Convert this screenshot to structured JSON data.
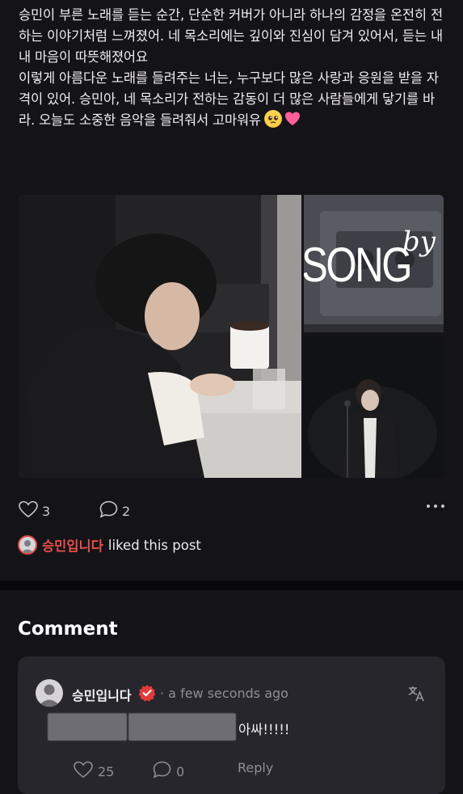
{
  "post": {
    "body": "승민이 부른 노래를 듣는 순간, 단순한 커버가 아니라 하나의 감정을 온전히 전하는 이야기처럼 느껴졌어. 네 목소리에는 깊이와 진심이 담겨 있어서, 듣는 내내 마음이 따뜻해졌어요\n이렇게 아름다운 노래를 들려주는 너는, 누구보다 많은 사랑과 응원을 받을 자격이 있어. 승민아, 네 목소리가 전하는 감동이 더 많은 사람들에게 닿기를 바라. 오늘도 소중한 음악을 들려줘서 고마워유",
    "emojis": [
      "pleading-face-icon",
      "pink-heart-icon"
    ],
    "gallery": {
      "song_image_text": "SONG",
      "song_image_script": "by"
    },
    "likes_count": "3",
    "comments_count": "2",
    "liked_by": {
      "name": "승민입니다",
      "suffix": "liked this post"
    }
  },
  "comments_section": {
    "title": "Comment",
    "items": [
      {
        "author": "승민입니다",
        "time": "· a few seconds ago",
        "text": "아싸!!!!!",
        "likes": "25",
        "replies": "0",
        "reply_label": "Reply"
      }
    ]
  },
  "colors": {
    "background": "#141318",
    "card": "#27262d",
    "accent_red": "#e84f4a",
    "muted": "#8f8c96"
  }
}
